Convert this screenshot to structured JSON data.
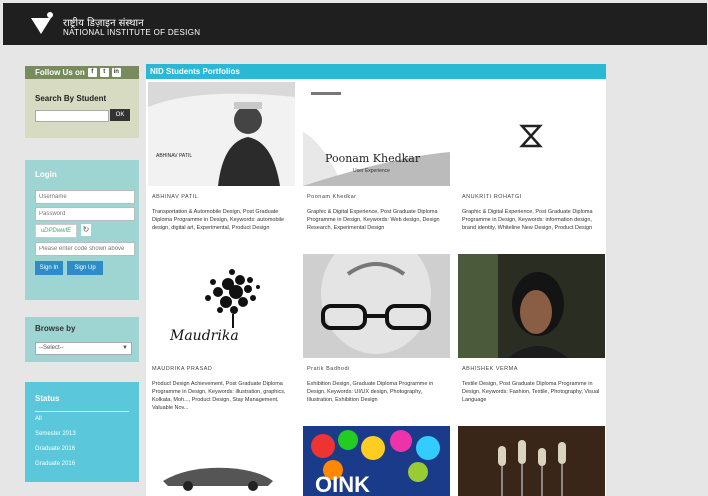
{
  "header": {
    "org_hindi": "राष्ट्रीय डिज़ाइन संस्थान",
    "org_english": "NATIONAL INSTITUTE OF DESIGN"
  },
  "follow": {
    "title": "Follow Us on",
    "social": [
      "f",
      "t",
      "in"
    ],
    "search_label": "Search By Student",
    "search_button": "OK"
  },
  "login": {
    "title": "Login",
    "username_placeholder": "Username",
    "password_placeholder": "Password",
    "captcha_text": "uDPDwwfE",
    "captcha_input_placeholder": "Please enter code shown above",
    "signin_button": "Sign In",
    "signup_button": "Sign Up"
  },
  "browse": {
    "title": "Browse by",
    "select_value": "--Select--"
  },
  "status": {
    "title": "Status",
    "items": [
      "All",
      "Semester 2013",
      "Graduate 2016",
      "Graduate 2016"
    ]
  },
  "main": {
    "title": "NID Students Portfolios",
    "cards": [
      {
        "name": "ABHINAV PATIL",
        "desc": "Transportation & Automobile Design, Post Graduate Diploma Programme in Design, Keywords: automobile design, digital art, Experimental, Product Design",
        "image": "portrait-photo"
      },
      {
        "name": "Poonam Khedkar",
        "desc": "Graphic & Digital Experience, Post Graduate Diploma Programme in Design, Keywords: Web design, Design Research, Experimental Design",
        "image": "poonam-khedkar-title"
      },
      {
        "name": "ANUKRITI ROHATGI",
        "desc": "Graphic & Digital Experience, Post Graduate Diploma Programme in Design, Keywords: information design, brand identity, Whiteline New Design, Product Design",
        "image": "hourglass-logo"
      },
      {
        "name": "MAUDRIKA PRASAD",
        "desc": "Product Design Achievement, Post Graduate Diploma Programme in Design, Keywords: illustration, graphics, Kolkata, Moh..., Product Design, Stay Management, Valuable Nov...",
        "image": "bubble-tree"
      },
      {
        "name": "Pratik Badhodi",
        "desc": "Exhibition Design, Graduate Diploma Programme in Design, Keywords: UI/UX design, Photography, Illustration, Exhibition Design",
        "image": "glasses-face"
      },
      {
        "name": "ABHISHEK VERMA",
        "desc": "Textile Design, Post Graduate Diploma Programme in Design, Keywords: Fashion, Textile, Photography, Visual Language",
        "image": "portrait-woman"
      },
      {
        "name": "",
        "desc": "",
        "image": "car-sketch"
      },
      {
        "name": "",
        "desc": "",
        "image": "oink-balls"
      },
      {
        "name": "",
        "desc": "",
        "image": "electronics"
      }
    ]
  }
}
